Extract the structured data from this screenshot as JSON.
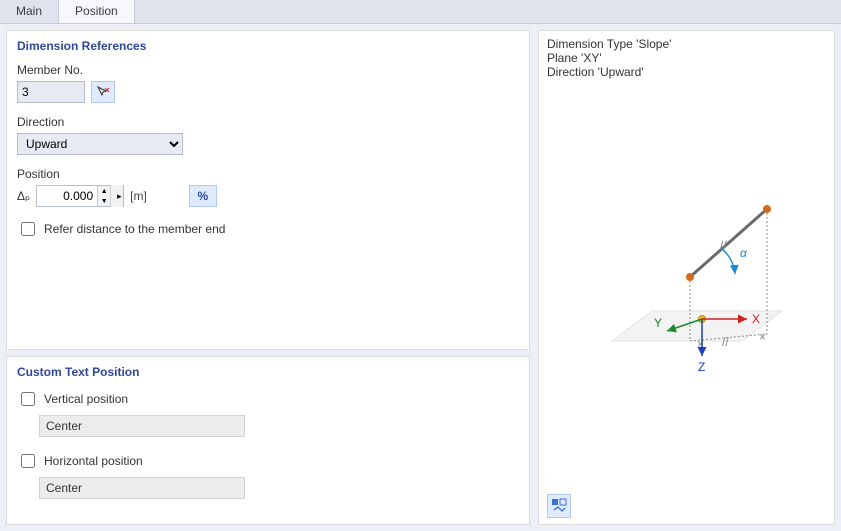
{
  "tabs": {
    "main": "Main",
    "position": "Position"
  },
  "dimRef": {
    "title": "Dimension References",
    "memberNoLabel": "Member No.",
    "memberNoValue": "3",
    "directionLabel": "Direction",
    "directionValue": "Upward",
    "positionLabel": "Position",
    "deltaSymbol": "Δₚ",
    "positionValue": "0.000",
    "unit": "[m]",
    "percent": "%",
    "referCheckbox": "Refer distance to the member end"
  },
  "customText": {
    "title": "Custom Text Position",
    "verticalLabel": "Vertical position",
    "verticalValue": "Center",
    "horizontalLabel": "Horizontal position",
    "horizontalValue": "Center"
  },
  "preview": {
    "line1": "Dimension Type 'Slope'",
    "line2": "Plane 'XY'",
    "line3": "Direction 'Upward'",
    "axis": {
      "x": "X",
      "y": "Y",
      "z": "Z",
      "alpha": "α"
    }
  },
  "colors": {
    "axisX": "#d32020",
    "axisY": "#1a8a2a",
    "axisZ": "#1a3fbf",
    "member": "#6a6a6a",
    "node": "#d36b1a",
    "origin": "#e6c21a",
    "angle": "#1a8acf"
  }
}
